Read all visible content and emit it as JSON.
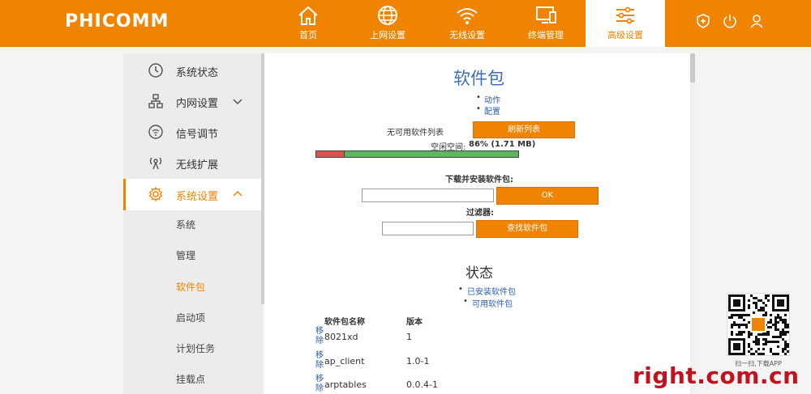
{
  "brand": {
    "logo": "PHICOMM"
  },
  "nav": [
    {
      "label": "首页",
      "icon": "home-icon"
    },
    {
      "label": "上网设置",
      "icon": "globe-icon"
    },
    {
      "label": "无线设置",
      "icon": "wifi-icon"
    },
    {
      "label": "终端管理",
      "icon": "devices-icon"
    },
    {
      "label": "高级设置",
      "icon": "sliders-icon"
    }
  ],
  "header_icons": [
    "shield-plus-icon",
    "power-icon",
    "user-icon"
  ],
  "sidebar": {
    "items": [
      {
        "label": "系统状态",
        "icon": "clock-icon"
      },
      {
        "label": "内网设置",
        "icon": "network-icon"
      },
      {
        "label": "信号调节",
        "icon": "signal-icon"
      },
      {
        "label": "无线扩展",
        "icon": "antenna-icon"
      },
      {
        "label": "系统设置",
        "icon": "gear-icon"
      }
    ],
    "sub_items": [
      "系统",
      "管理",
      "软件包",
      "启动项",
      "计划任务",
      "挂载点"
    ]
  },
  "main": {
    "title": "软件包",
    "links": [
      "动作",
      "配置"
    ],
    "no_list_text": "无可用软件列表",
    "refresh_button": "刷新列表",
    "free_space_label": "空闲空间:",
    "free_space_value": "86% (1.71 MB)",
    "free_space_percent": 86,
    "download_label": "下载并安装软件包:",
    "download_value": "",
    "ok_button": "OK",
    "filter_label": "过滤器:",
    "filter_value": "",
    "find_button": "查找软件包",
    "status_title": "状态",
    "status_links": [
      "已安装软件包",
      "可用软件包"
    ],
    "table": {
      "headers": [
        "软件包名称",
        "版本"
      ],
      "remove_label": "移除",
      "rows": [
        {
          "name": "8021xd",
          "version": "1"
        },
        {
          "name": "ap_client",
          "version": "1.0-1"
        },
        {
          "name": "arptables",
          "version": "0.0.4-1"
        }
      ]
    }
  },
  "qr": {
    "caption": "扫一扫,下载APP"
  },
  "watermark": "right.com.cn",
  "colors": {
    "accent": "#f08300",
    "link": "#2a5db0",
    "title": "#3d6fb6",
    "used": "#d9534f",
    "free": "#5cb85c"
  }
}
